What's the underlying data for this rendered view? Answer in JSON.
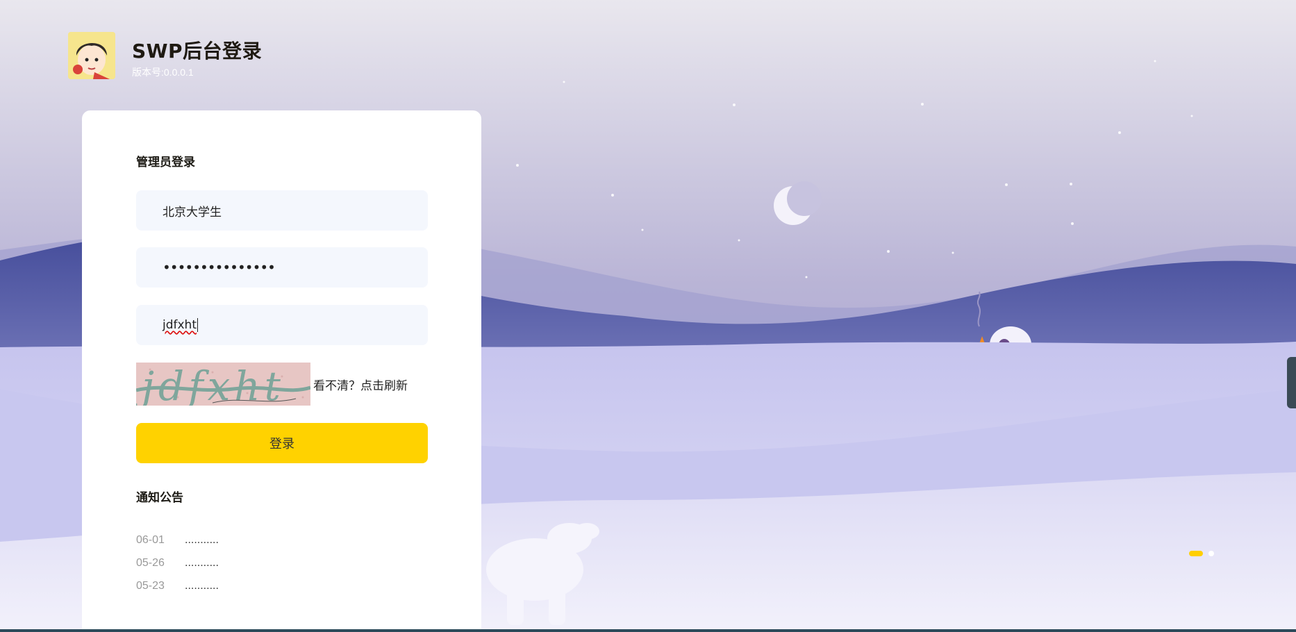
{
  "header": {
    "title": "SWP后台登录",
    "version": "版本号:0.0.0.1",
    "avatar_icon": "cartoon-avatar-icon"
  },
  "login": {
    "section_title": "管理员登录",
    "username_value": "北京大学生",
    "password_value": "•••••••••••••••",
    "captcha_value": "jdfxht",
    "captcha_image_text": "jdfxht",
    "refresh_label": "看不清？点击刷新",
    "submit_label": "登录"
  },
  "notices": {
    "title": "通知公告",
    "items": [
      {
        "date": "06-01",
        "text": "..........."
      },
      {
        "date": "05-26",
        "text": "..........."
      },
      {
        "date": "05-23",
        "text": "..........."
      }
    ]
  },
  "carousel": {
    "pages": 2,
    "active": 1
  },
  "colors": {
    "accent": "#ffd200",
    "input_bg": "#f4f7fd",
    "sky_top": "#e8e6ef",
    "mountain": "#4a519e"
  }
}
